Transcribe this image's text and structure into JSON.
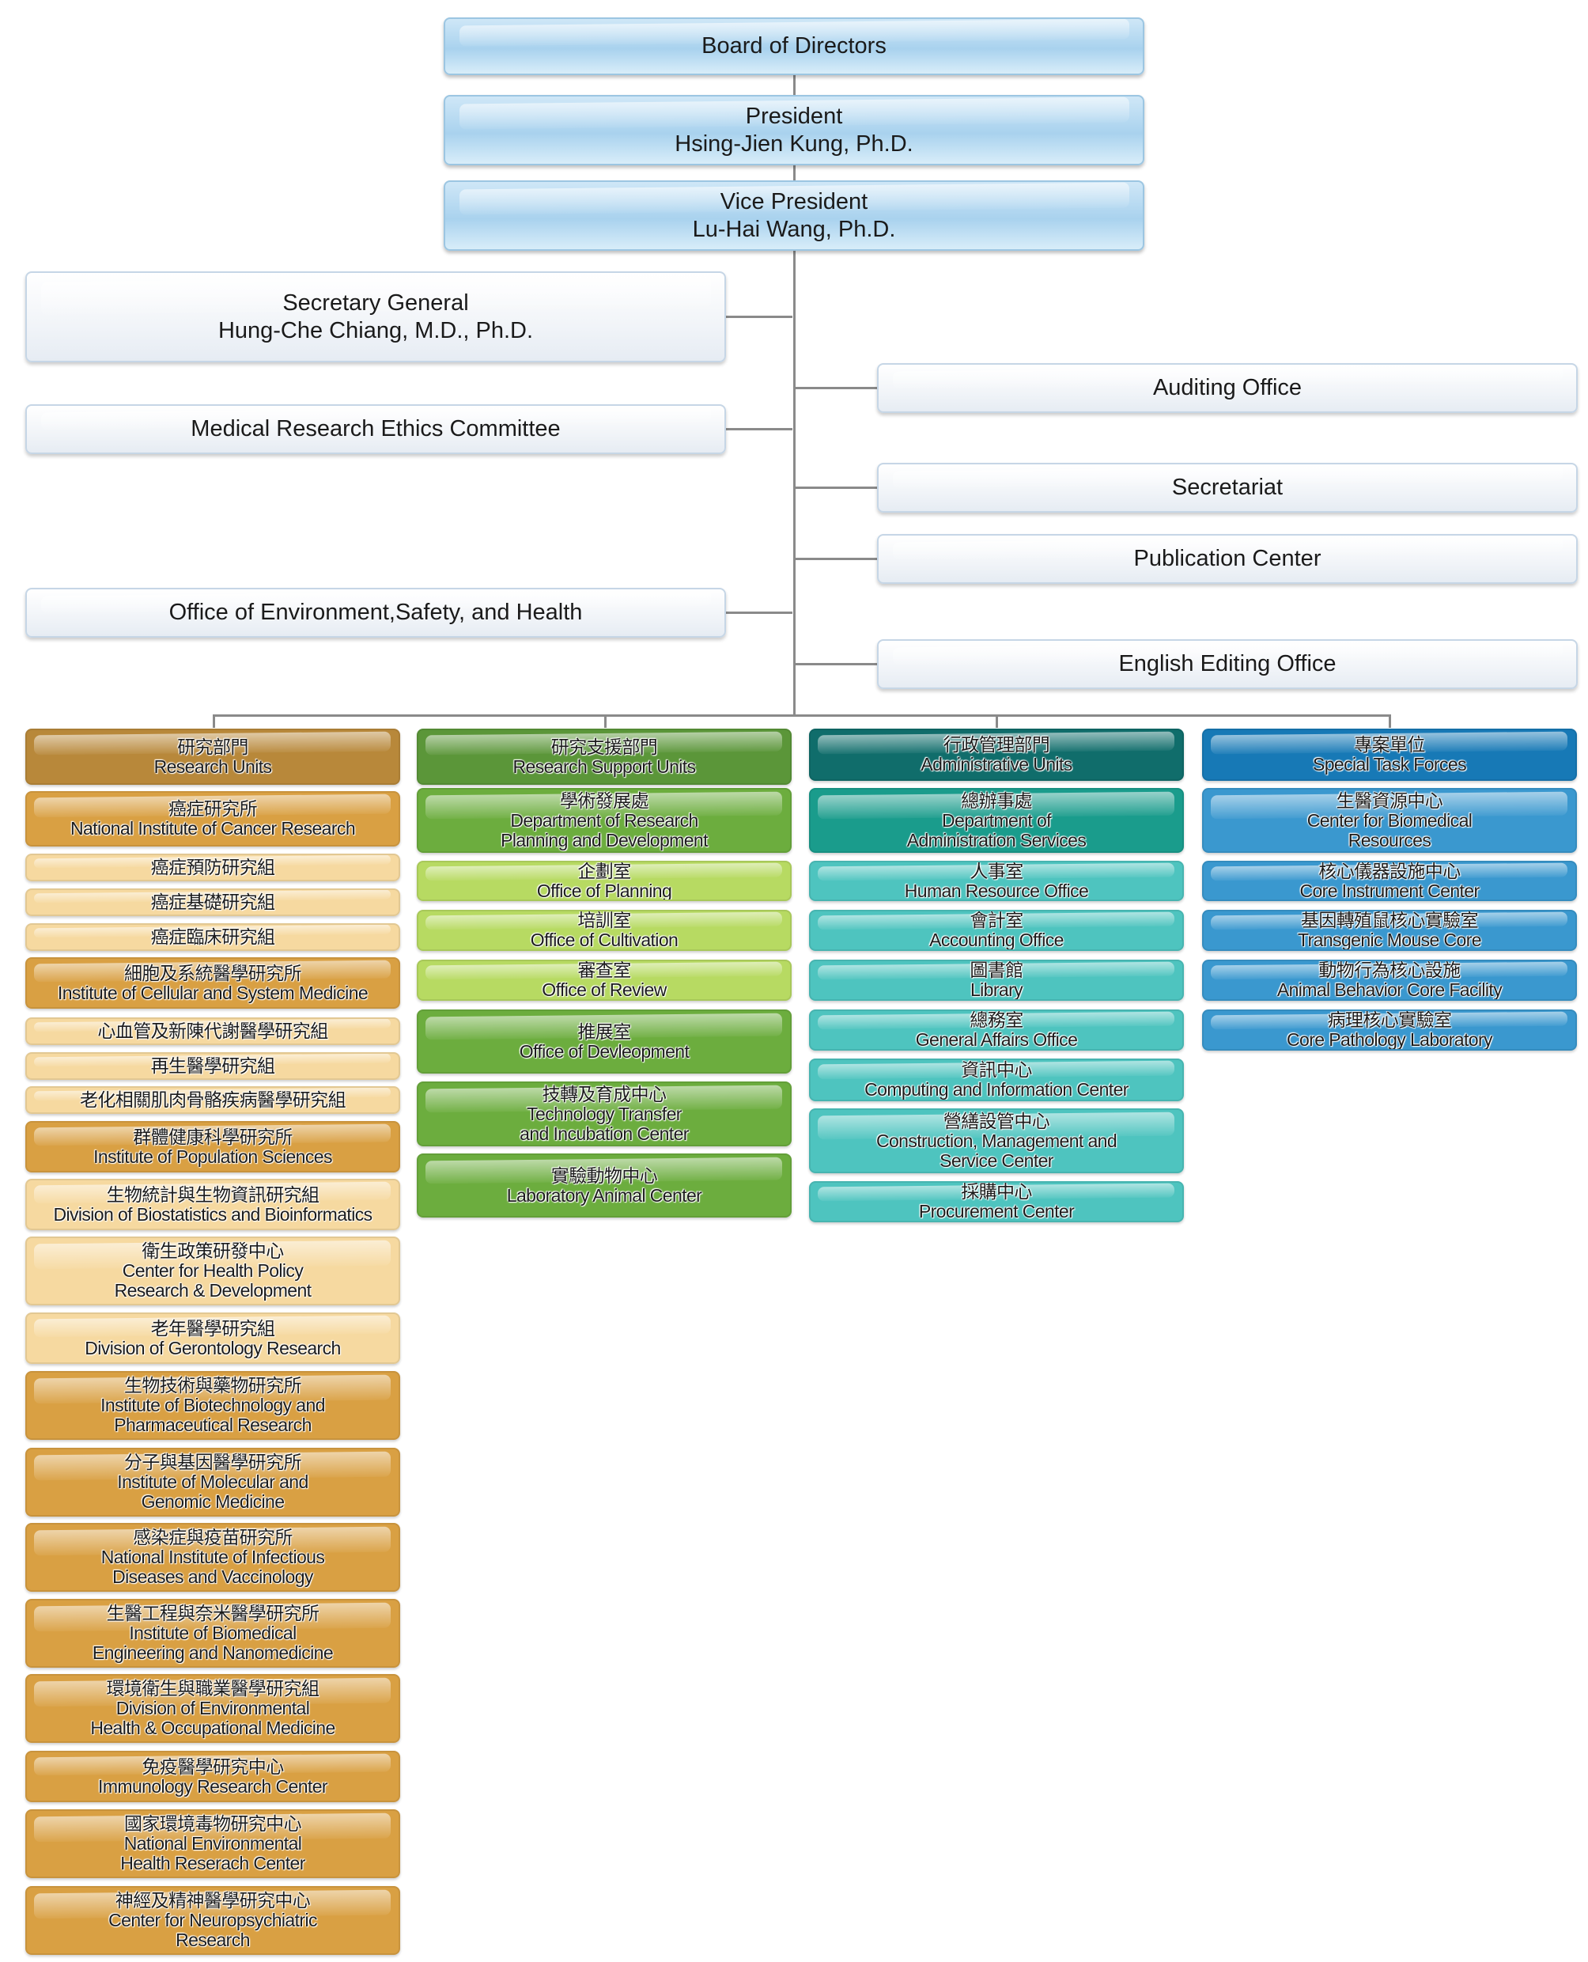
{
  "top": [
    {
      "lines": [
        "Board of Directors"
      ]
    },
    {
      "lines": [
        "President",
        "Hsing-Jien Kung, Ph.D."
      ]
    },
    {
      "lines": [
        "Vice President",
        "Lu-Hai Wang, Ph.D."
      ]
    }
  ],
  "left_offices": [
    {
      "lines": [
        "Secretary General",
        "Hung-Che Chiang, M.D., Ph.D."
      ]
    },
    {
      "lines": [
        "Medical Research Ethics Committee"
      ]
    },
    {
      "lines": [
        "Office of Environment,Safety, and Health"
      ]
    }
  ],
  "right_offices": [
    {
      "lines": [
        "Auditing Office"
      ]
    },
    {
      "lines": [
        "Secretariat"
      ]
    },
    {
      "lines": [
        "Publication Center"
      ]
    },
    {
      "lines": [
        "English Editing Office"
      ]
    }
  ],
  "columns": [
    {
      "colors": {
        "dark": "#b8883a",
        "mid": "#d9a043",
        "light": "#f6d9a0"
      },
      "items": [
        {
          "tone": "dark",
          "lines": [
            "研究部門",
            "Research Units"
          ]
        },
        {
          "tone": "mid",
          "lines": [
            "癌症研究所",
            "National Institute of Cancer Research"
          ]
        },
        {
          "tone": "light",
          "lines": [
            "癌症預防研究組"
          ]
        },
        {
          "tone": "light",
          "lines": [
            "癌症基礎研究組"
          ]
        },
        {
          "tone": "light",
          "lines": [
            "癌症臨床研究組"
          ]
        },
        {
          "tone": "mid",
          "lines": [
            "細胞及系統醫學研究所",
            "Institute of Cellular and System Medicine"
          ]
        },
        {
          "tone": "light",
          "lines": [
            "心血管及新陳代謝醫學研究組"
          ]
        },
        {
          "tone": "light",
          "lines": [
            "再生醫學研究組"
          ]
        },
        {
          "tone": "light",
          "lines": [
            "老化相關肌肉骨骼疾病醫學研究組"
          ]
        },
        {
          "tone": "mid",
          "lines": [
            "群體健康科學研究所",
            "Institute of Population Sciences"
          ]
        },
        {
          "tone": "light",
          "lines": [
            "生物統計與生物資訊研究組",
            "Division of Biostatistics and Bioinformatics"
          ]
        },
        {
          "tone": "light",
          "lines": [
            "衛生政策研發中心",
            "Center for Health Policy",
            "Research & Development"
          ]
        },
        {
          "tone": "light",
          "lines": [
            "老年醫學研究組",
            "Division of Gerontology Research"
          ]
        },
        {
          "tone": "mid",
          "lines": [
            "生物技術與藥物研究所",
            "Institute of Biotechnology and",
            "Pharmaceutical Research"
          ]
        },
        {
          "tone": "mid",
          "lines": [
            "分子與基因醫學研究所",
            "Institute of Molecular and",
            "Genomic Medicine"
          ]
        },
        {
          "tone": "mid",
          "lines": [
            "感染症與疫苗研究所",
            "National Institute of Infectious",
            "Diseases and Vaccinology"
          ]
        },
        {
          "tone": "mid",
          "lines": [
            "生醫工程與奈米醫學研究所",
            "Institute of Biomedical",
            "Engineering and Nanomedicine"
          ]
        },
        {
          "tone": "mid",
          "lines": [
            "環境衛生與職業醫學研究組",
            "Division of Environmental",
            "Health & Occupational Medicine"
          ]
        },
        {
          "tone": "mid",
          "lines": [
            "免疫醫學研究中心",
            "Immunology Research Center"
          ]
        },
        {
          "tone": "mid",
          "lines": [
            "國家環境毒物研究中心",
            "National Environmental",
            "Health Reserach Center"
          ]
        },
        {
          "tone": "mid",
          "lines": [
            "神經及精神醫學研究中心",
            "Center for Neuropsychiatric",
            "Research"
          ]
        }
      ]
    },
    {
      "colors": {
        "dark": "#5b9639",
        "mid": "#6cad3e",
        "light": "#b7da62"
      },
      "items": [
        {
          "tone": "dark",
          "lines": [
            "研究支援部門",
            "Research Support Units"
          ]
        },
        {
          "tone": "mid",
          "lines": [
            "學術發展處",
            "Department of Research",
            "Planning and Development"
          ]
        },
        {
          "tone": "light",
          "lines": [
            "企劃室",
            "Office of Planning"
          ]
        },
        {
          "tone": "light",
          "lines": [
            "培訓室",
            "Office of Cultivation"
          ]
        },
        {
          "tone": "light",
          "lines": [
            "審查室",
            "Office of Review"
          ]
        },
        {
          "tone": "mid",
          "lines": [
            "推展室",
            "Office of Devleopment"
          ]
        },
        {
          "tone": "mid",
          "lines": [
            "技轉及育成中心",
            "Technology Transfer",
            "and Incubation Center"
          ]
        },
        {
          "tone": "mid",
          "lines": [
            "實驗動物中心",
            "Laboratory Animal Center"
          ]
        }
      ]
    },
    {
      "colors": {
        "dark": "#106d6b",
        "mid": "#1a9c8c",
        "light": "#4ec4bf"
      },
      "items": [
        {
          "tone": "dark",
          "lines": [
            "行政管理部門",
            "Administrative Units"
          ]
        },
        {
          "tone": "mid",
          "lines": [
            "總辦事處",
            "Department of",
            "Administration Services"
          ]
        },
        {
          "tone": "light",
          "lines": [
            "人事室",
            "Human Resource Office"
          ]
        },
        {
          "tone": "light",
          "lines": [
            "會計室",
            "Accounting Office"
          ]
        },
        {
          "tone": "light",
          "lines": [
            "圖書館",
            "Library"
          ]
        },
        {
          "tone": "light",
          "lines": [
            "總務室",
            "General Affairs Office"
          ]
        },
        {
          "tone": "light",
          "lines": [
            "資訊中心",
            "Computing and Information Center"
          ]
        },
        {
          "tone": "light",
          "lines": [
            "營繕設管中心",
            "Construction, Management and",
            "Service Center"
          ]
        },
        {
          "tone": "light",
          "lines": [
            "採購中心",
            "Procurement Center"
          ]
        }
      ]
    },
    {
      "colors": {
        "dark": "#1779b6",
        "mid": "#3a98cf",
        "light": "#3a98cf"
      },
      "items": [
        {
          "tone": "dark",
          "lines": [
            "專案單位",
            "Special Task Forces"
          ]
        },
        {
          "tone": "mid",
          "lines": [
            "生醫資源中心",
            "Center for Biomedical",
            "Resources"
          ]
        },
        {
          "tone": "mid",
          "lines": [
            "核心儀器設施中心",
            "Core Instrument Center"
          ]
        },
        {
          "tone": "mid",
          "lines": [
            "基因轉殖鼠核心實驗室",
            "Transgenic Mouse Core"
          ]
        },
        {
          "tone": "mid",
          "lines": [
            "動物行為核心設施",
            "Animal Behavior Core Facility"
          ]
        },
        {
          "tone": "mid",
          "lines": [
            "病理核心實驗室",
            "Core Pathology Laboratory"
          ]
        }
      ]
    }
  ]
}
